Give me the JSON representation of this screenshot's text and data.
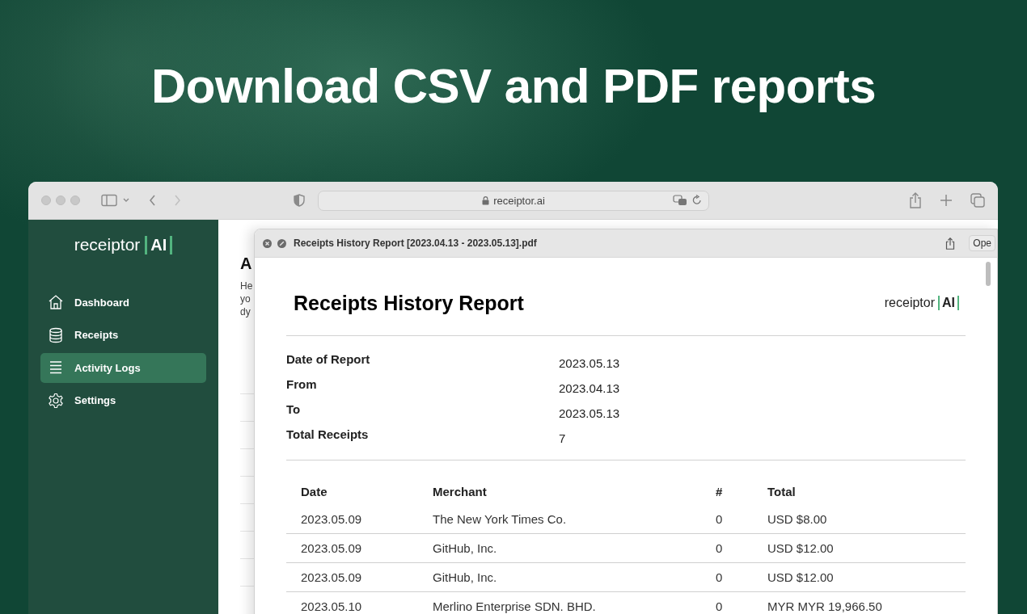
{
  "headline": "Download CSV and PDF reports",
  "browser": {
    "url": "receiptor.ai"
  },
  "sidebar": {
    "logo": {
      "text": "receiptor",
      "mark": "AI"
    },
    "items": [
      {
        "label": "Dashboard",
        "selected": false
      },
      {
        "label": "Receipts",
        "selected": false
      },
      {
        "label": "Activity Logs",
        "selected": true
      },
      {
        "label": "Settings",
        "selected": false
      }
    ]
  },
  "background_page": {
    "title": "A",
    "description_lines": [
      "He",
      "yo",
      "dy"
    ]
  },
  "pdf_viewer": {
    "file_name": "Receipts History Report [2023.04.13 - 2023.05.13].pdf",
    "open_button": "Ope",
    "report": {
      "title": "Receipts History Report",
      "logo": {
        "text": "receiptor",
        "mark": "AI"
      },
      "details": [
        {
          "label": "Date of Report",
          "value": "2023.05.13"
        },
        {
          "label": "From",
          "value": "2023.04.13"
        },
        {
          "label": "To",
          "value": "2023.05.13"
        },
        {
          "label": "Total Receipts",
          "value": "7"
        }
      ],
      "table": {
        "columns": [
          "Date",
          "Merchant",
          "#",
          "Total"
        ],
        "rows": [
          [
            "2023.05.09",
            "The New York Times Co.",
            "0",
            "USD $8.00"
          ],
          [
            "2023.05.09",
            "GitHub, Inc.",
            "0",
            "USD $12.00"
          ],
          [
            "2023.05.09",
            "GitHub, Inc.",
            "0",
            "USD $12.00"
          ],
          [
            "2023.05.10",
            "Merlino Enterprise SDN. BHD.",
            "0",
            "MYR MYR 19,966.50"
          ]
        ]
      }
    }
  }
}
